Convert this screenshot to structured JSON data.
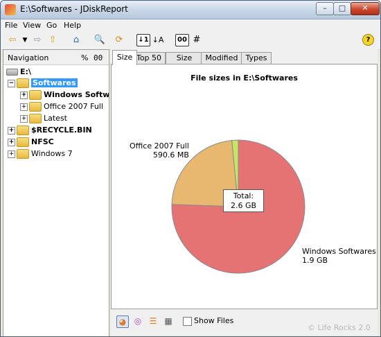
{
  "window": {
    "title": "E:\\Softwares - JDiskReport",
    "min_glyph": "–",
    "max_glyph": "□",
    "close_glyph": "✕"
  },
  "menu": [
    {
      "label": "File"
    },
    {
      "label": "View"
    },
    {
      "label": "Go"
    },
    {
      "label": "Help"
    }
  ],
  "toolbar": {
    "sort_size_label": "↓1",
    "sort_name_label": "↓A",
    "percent_toggle_label": "00",
    "hash_label": "#",
    "help_label": "?"
  },
  "navigation": {
    "title": "Navigation",
    "percent_label": "%",
    "number_label": "00",
    "tree": [
      {
        "label": "E:\\",
        "type": "drive",
        "expander": "",
        "bold": true
      },
      {
        "label": "Softwares",
        "type": "folder",
        "expander": "−",
        "bold": true,
        "selected": true
      },
      {
        "label": "Windows Softwa",
        "type": "folder",
        "expander": "+",
        "bold": true
      },
      {
        "label": "Office 2007 Full",
        "type": "folder",
        "expander": "+",
        "bold": false
      },
      {
        "label": "Latest",
        "type": "folder",
        "expander": "+",
        "bold": false
      },
      {
        "label": "$RECYCLE.BIN",
        "type": "folder",
        "expander": "+",
        "bold": true
      },
      {
        "label": "NFSC",
        "type": "folder",
        "expander": "+",
        "bold": true
      },
      {
        "label": "Windows 7",
        "type": "folder",
        "expander": "+",
        "bold": false
      }
    ]
  },
  "tabs": [
    {
      "label": "Size",
      "active": true
    },
    {
      "label": "Top 50",
      "active": false
    },
    {
      "label": "Size Dist",
      "active": false
    },
    {
      "label": "Modified",
      "active": false
    },
    {
      "label": "Types",
      "active": false
    }
  ],
  "chart_data": {
    "type": "pie",
    "title": "File sizes in E:\\Softwares",
    "slices": [
      {
        "name": "Windows Softwares",
        "value_label": "1.9 GB",
        "value_mb": 1946,
        "color": "#e57373"
      },
      {
        "name": "Office 2007 Full",
        "value_label": "590.6 MB",
        "value_mb": 590.6,
        "color": "#e8b870"
      },
      {
        "name": "Latest",
        "value_label": "",
        "value_mb": 40,
        "color": "#c5e567"
      }
    ],
    "total_label": "Total:",
    "total_value": "2.6 GB"
  },
  "bottom": {
    "show_files_label": "Show Files"
  },
  "watermark": "© Life Rocks 2.0"
}
